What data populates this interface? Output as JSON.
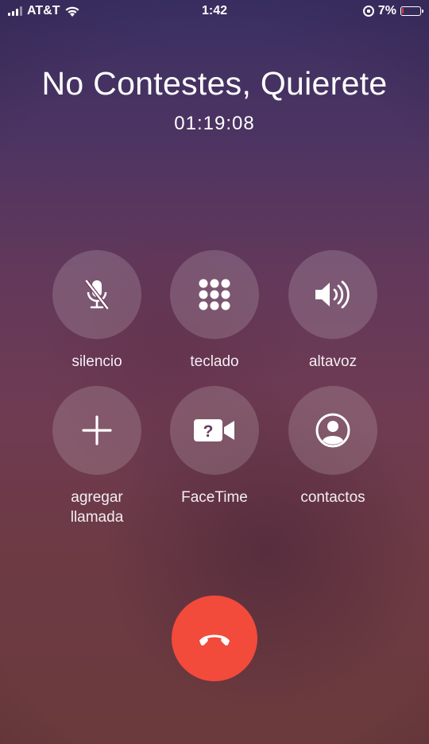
{
  "status_bar": {
    "carrier": "AT&T",
    "time": "1:42",
    "battery": "7%"
  },
  "call": {
    "caller_name": "No Contestes, Quierete",
    "duration": "01:19:08"
  },
  "controls": {
    "mute": "silencio",
    "keypad": "teclado",
    "speaker": "altavoz",
    "add_call_line1": "agregar",
    "add_call_line2": "llamada",
    "facetime": "FaceTime",
    "contacts": "contactos"
  },
  "colors": {
    "end_call": "#f24a3b"
  }
}
